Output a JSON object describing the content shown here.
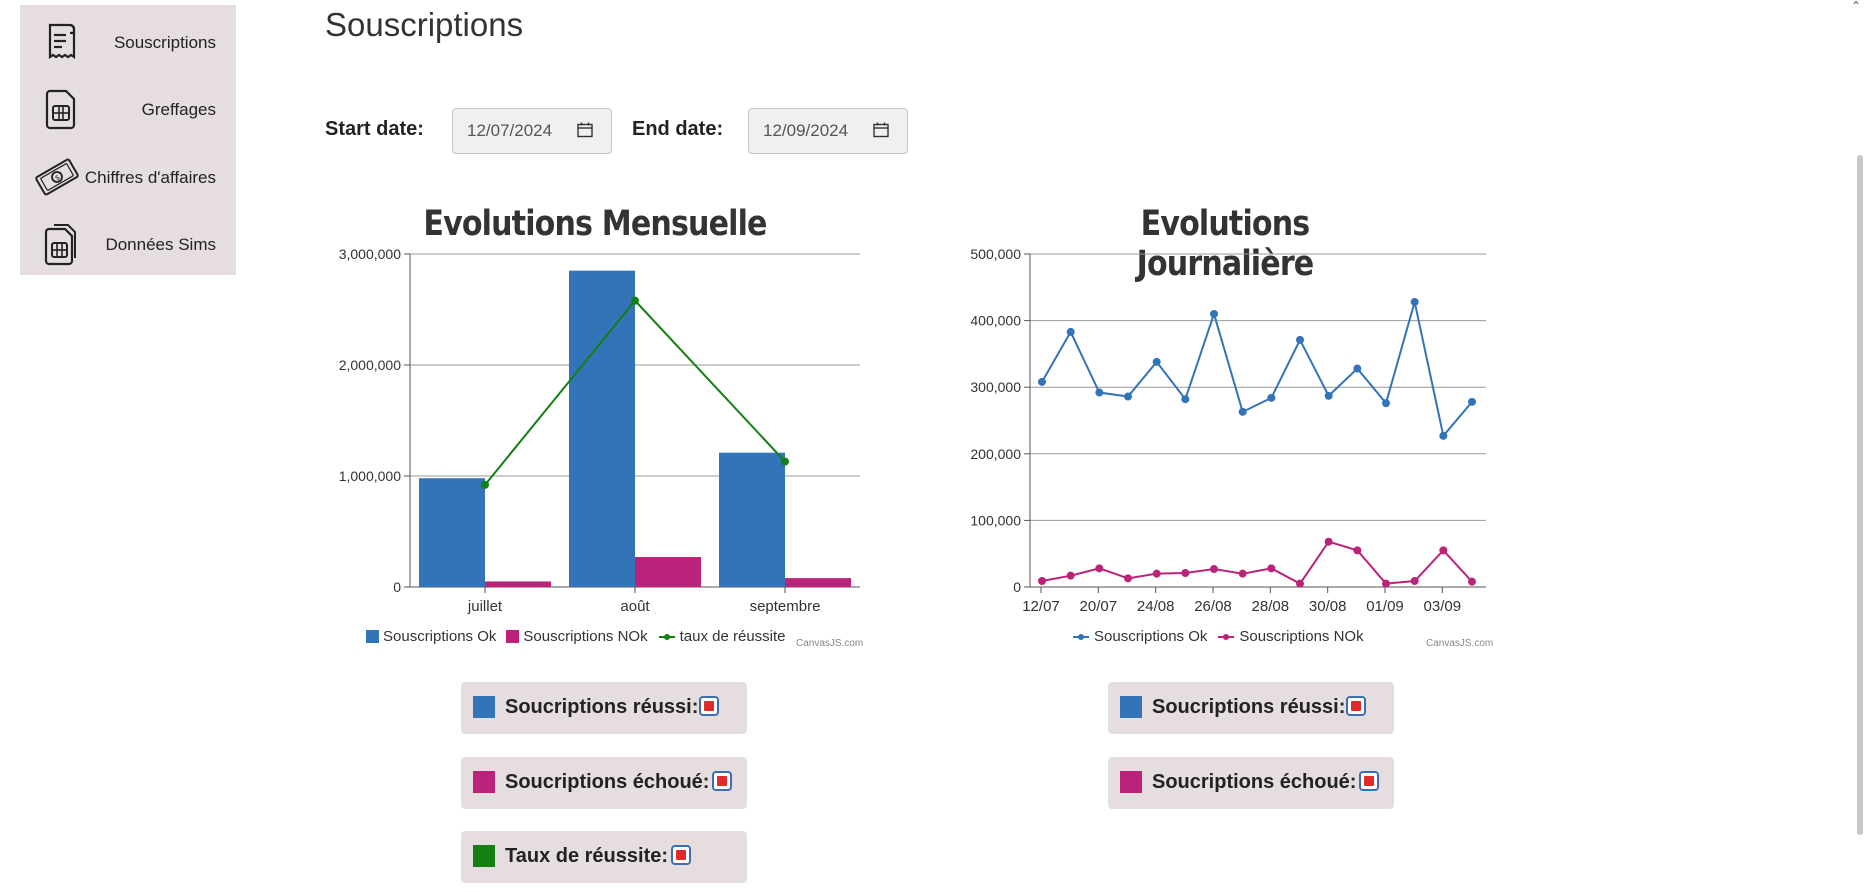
{
  "sidebar": {
    "items": [
      {
        "label": "Souscriptions",
        "icon": "receipt-icon"
      },
      {
        "label": "Greffages",
        "icon": "sim-card-icon"
      },
      {
        "label": "Chiffres d'affaires",
        "icon": "money-icon"
      },
      {
        "label": "Données Sims",
        "icon": "sim-cards-icon"
      }
    ]
  },
  "header": {
    "title": "Souscriptions"
  },
  "filters": {
    "start_label": "Start date:",
    "start_value": "12/07/2024",
    "end_label": "End date:",
    "end_value": "12/09/2024"
  },
  "colors": {
    "blue": "#3373b8",
    "magenta": "#bb237b",
    "green": "#128012",
    "panel": "#e6dede"
  },
  "chart_data": [
    {
      "type": "bar",
      "title": "Evolutions Mensuelle",
      "categories": [
        "juillet",
        "août",
        "septembre"
      ],
      "y_ticks": [
        "0",
        "1,000,000",
        "2,000,000",
        "3,000,000"
      ],
      "ylim": [
        0,
        3000000
      ],
      "series": [
        {
          "name": "Souscriptions Ok",
          "type": "bar",
          "color": "#3373b8",
          "values": [
            980000,
            2850000,
            1210000
          ]
        },
        {
          "name": "Souscriptions NOk",
          "type": "bar",
          "color": "#bb237b",
          "values": [
            50000,
            270000,
            80000
          ]
        },
        {
          "name": "taux de réussite",
          "type": "line",
          "color": "#128012",
          "values": [
            920000,
            2580000,
            1130000
          ]
        }
      ],
      "credit": "CanvasJS.com"
    },
    {
      "type": "line",
      "title": "Evolutions Journalière",
      "x_labels": [
        "12/07",
        "20/07",
        "24/08",
        "26/08",
        "28/08",
        "30/08",
        "01/09",
        "03/09"
      ],
      "y_ticks": [
        "0",
        "100,000",
        "200,000",
        "300,000",
        "400,000",
        "500,000"
      ],
      "ylim": [
        0,
        500000
      ],
      "series": [
        {
          "name": "Souscriptions Ok",
          "color": "#3373b8",
          "values": [
            308000,
            383000,
            292000,
            286000,
            338000,
            282000,
            410000,
            263000,
            284000,
            371000,
            287000,
            328000,
            276000,
            428000,
            227000,
            278000
          ]
        },
        {
          "name": "Souscriptions NOk",
          "color": "#bb237b",
          "values": [
            9000,
            17000,
            28000,
            13000,
            20000,
            21000,
            27000,
            20000,
            28000,
            5000,
            68000,
            55000,
            5000,
            9000,
            55000,
            8000
          ]
        }
      ],
      "credit": "CanvasJS.com"
    }
  ],
  "toggles_left": [
    {
      "label": "Soucriptions réussi:",
      "color": "#3373b8"
    },
    {
      "label": "Soucriptions échoué:",
      "color": "#bb237b"
    },
    {
      "label": "Taux de réussite:",
      "color": "#128012"
    }
  ],
  "toggles_right": [
    {
      "label": "Soucriptions réussi:",
      "color": "#3373b8"
    },
    {
      "label": "Soucriptions échoué:",
      "color": "#bb237b"
    }
  ]
}
